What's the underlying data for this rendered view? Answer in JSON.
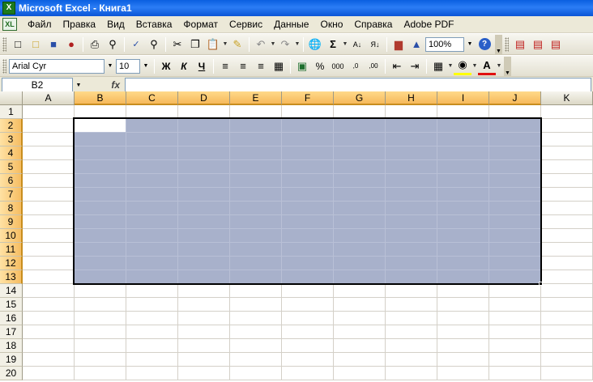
{
  "window": {
    "title": "Microsoft Excel - Книга1",
    "app_icon": "excel-icon"
  },
  "menu": {
    "doc_icon": "workbook-icon",
    "items": [
      "Файл",
      "Правка",
      "Вид",
      "Вставка",
      "Формат",
      "Сервис",
      "Данные",
      "Окно",
      "Справка",
      "Adobe PDF"
    ]
  },
  "standard_toolbar": {
    "zoom": "100%"
  },
  "formatting_toolbar": {
    "font": "Arial Cyr",
    "size": "10",
    "bold": "Ж",
    "italic": "К",
    "underline": "Ч"
  },
  "formula_bar": {
    "name_box": "B2",
    "fx_label": "fx",
    "content": ""
  },
  "sheet": {
    "columns": [
      "A",
      "B",
      "C",
      "D",
      "E",
      "F",
      "G",
      "H",
      "I",
      "J",
      "K"
    ],
    "rows": [
      "1",
      "2",
      "3",
      "4",
      "5",
      "6",
      "7",
      "8",
      "9",
      "10",
      "11",
      "12",
      "13",
      "14",
      "15",
      "16",
      "17",
      "18",
      "19",
      "20"
    ],
    "selection": {
      "range": "B2:J13",
      "active_cell": "B2"
    },
    "colors": {
      "selection_fill": "#a8b1cb",
      "header_highlight": "#f6b95b"
    }
  }
}
